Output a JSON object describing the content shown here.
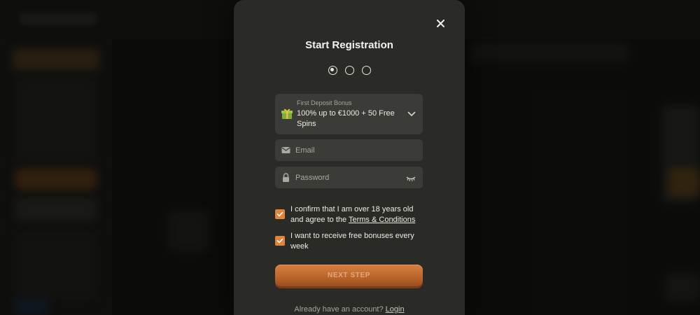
{
  "modal": {
    "title": "Start Registration",
    "steps": [
      {
        "active": true
      },
      {
        "active": false
      },
      {
        "active": false
      }
    ],
    "bonus": {
      "label": "First Deposit Bonus",
      "value": "100% up to €1000 + 50 Free Spins",
      "icon": "gift-icon"
    },
    "email": {
      "placeholder": "Email",
      "value": "",
      "icon": "envelope-icon"
    },
    "password": {
      "placeholder": "Password",
      "value": "",
      "icon": "lock-icon"
    },
    "age_check": {
      "checked": true,
      "text": "I confirm that I am over 18 years old and agree to the ",
      "link": "Terms & Conditions"
    },
    "bonus_check": {
      "checked": true,
      "text": "I want to receive free bonuses every week"
    },
    "next_label": "NEXT STEP",
    "login_prompt": "Already have an account? ",
    "login_link": "Login"
  },
  "colors": {
    "accent": "#e0843a",
    "modal_bg": "#2a2a26",
    "field_bg": "#3b3b37"
  }
}
